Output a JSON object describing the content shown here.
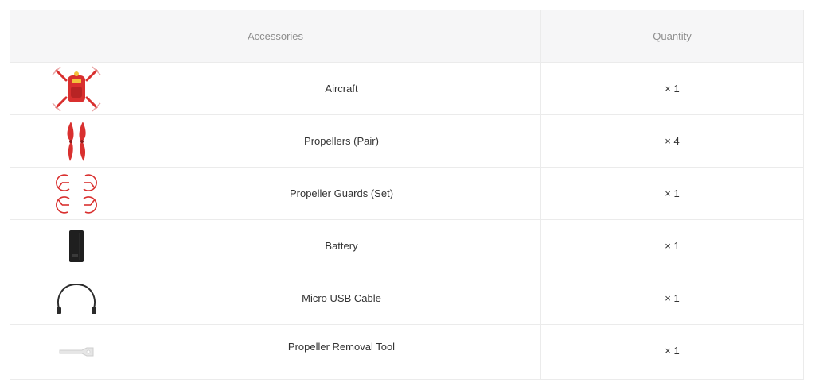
{
  "table": {
    "header": {
      "accessories": "Accessories",
      "quantity": "Quantity"
    },
    "rows": [
      {
        "icon": "aircraft-icon",
        "name": "Aircraft",
        "qty": "× 1"
      },
      {
        "icon": "propellers-icon",
        "name": "Propellers (Pair)",
        "qty": "× 4"
      },
      {
        "icon": "propeller-guards-icon",
        "name": "Propeller Guards (Set)",
        "qty": "× 1"
      },
      {
        "icon": "battery-icon",
        "name": "Battery",
        "qty": "× 1"
      },
      {
        "icon": "usb-cable-icon",
        "name": "Micro USB Cable",
        "qty": "× 1"
      },
      {
        "icon": "removal-tool-icon",
        "name": "Propeller Removal Tool",
        "qty": "× 1"
      }
    ]
  },
  "colors": {
    "accent": "#d9302f",
    "border": "#ebebeb",
    "header_bg": "#f6f6f7"
  }
}
